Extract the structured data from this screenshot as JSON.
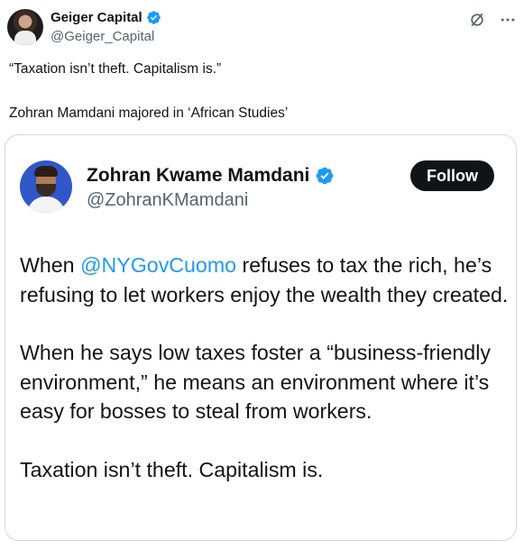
{
  "author": {
    "name": "Geiger Capital",
    "handle": "@Geiger_Capital"
  },
  "tweet": {
    "line1": "“Taxation isn’t theft. Capitalism is.”",
    "line2": "Zohran Mamdani majored in ‘African Studies’"
  },
  "quoted": {
    "name": "Zohran Kwame Mamdani",
    "handle": "@ZohranKMamdani",
    "follow_label": "Follow",
    "p1_before": "When ",
    "p1_mention": "@NYGovCuomo",
    "p1_after": " refuses to tax the rich, he’s refusing to let workers enjoy the wealth they created.",
    "p2": "When he says low taxes foster a “business-friendly environment,” he means an environment where it’s easy for bosses to steal from workers.",
    "p3": "Taxation isn’t theft. Capitalism is."
  },
  "colors": {
    "verified": "#1d9bf0",
    "mention": "#1d9bf0",
    "follow_bg": "#0f1419",
    "border": "#cfd9de"
  },
  "icons": [
    "verified-badge-icon",
    "grok-icon",
    "more-icon"
  ]
}
